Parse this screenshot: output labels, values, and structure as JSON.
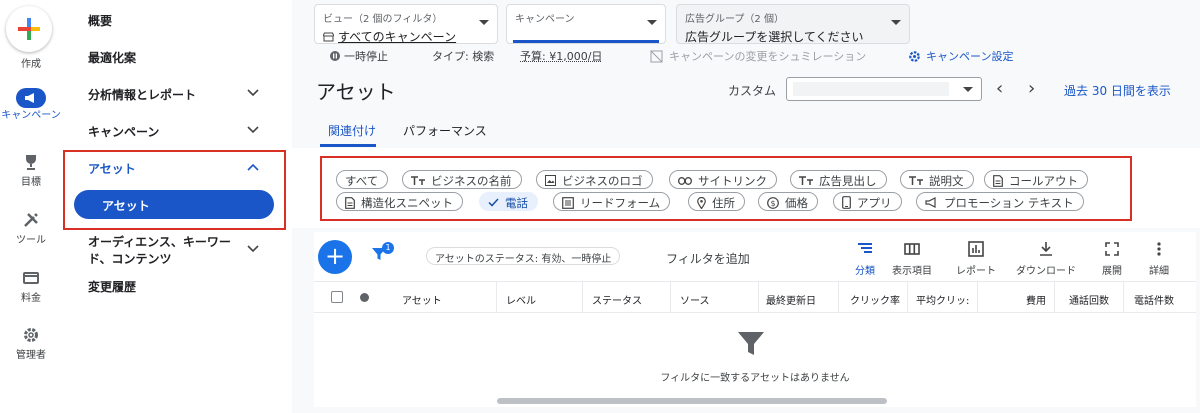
{
  "rail": {
    "create": "作成",
    "campaign": "キャンペーン",
    "goals": "目標",
    "tools": "ツール",
    "billing": "料金",
    "admin": "管理者"
  },
  "sidebar": {
    "overview": "概要",
    "recommendations": "最適化案",
    "insights": "分析情報とレポート",
    "campaigns": "キャンペーン",
    "assets": "アセット",
    "assets_sub": "アセット",
    "audiences": "オーディエンス、キーワード、コンテンツ",
    "change_history": "変更履歴"
  },
  "header": {
    "view_label": "ビュー（2 個のフィルタ）",
    "view_value": "すべてのキャンペーン",
    "campaign_label": "キャンペーン",
    "adgroup_label": "広告グループ（2 個）",
    "adgroup_value": "広告グループを選択してください",
    "status": "一時停止",
    "type": "タイプ: 検索",
    "budget": "予算: ¥1,000/日",
    "simulate": "キャンペーンの変更をシュミレーション",
    "settings": "キャンペーン設定"
  },
  "page": {
    "title": "アセット",
    "custom_label": "カスタム",
    "period": "過去 30 日間を表示"
  },
  "tabs": [
    "関連付け",
    "パフォーマンス"
  ],
  "chips": {
    "row1": [
      "すべて",
      "ビジネスの名前",
      "ビジネスのロゴ",
      "サイトリンク",
      "広告見出し",
      "説明文",
      "コールアウト"
    ],
    "row2": [
      "構造化スニペット",
      "電話",
      "リードフォーム",
      "住所",
      "価格",
      "アプリ",
      "プロモーション テキスト"
    ]
  },
  "toolbar": {
    "filter_count": "1",
    "status_filter": "アセットのステータス: 有効、一時停止",
    "add_filter": "フィルタを追加",
    "segment": "分類",
    "columns": "表示項目",
    "reports": "レポート",
    "download": "ダウンロード",
    "expand": "展開",
    "more": "詳細"
  },
  "table": {
    "headers": [
      "アセット",
      "レベル",
      "ステータス",
      "ソース",
      "最終更新日",
      "クリック率",
      "平均クリッ:",
      "費用",
      "通話回数",
      "電話件数"
    ],
    "empty": "フィルタに一致するアセットはありません"
  },
  "colors": {
    "accent": "#1a56c8",
    "highlight": "#d93025"
  }
}
